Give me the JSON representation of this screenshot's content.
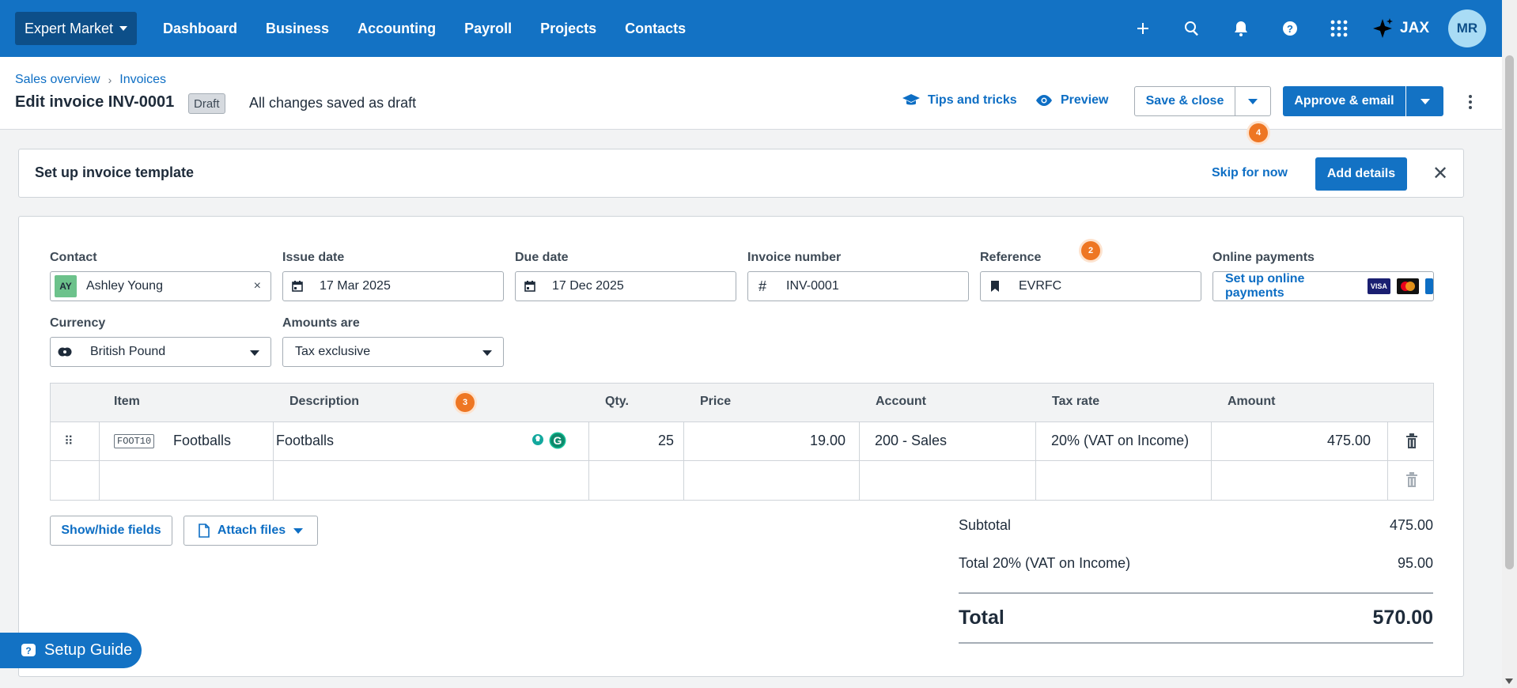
{
  "nav": {
    "org": "Expert Market",
    "items": [
      "Dashboard",
      "Business",
      "Accounting",
      "Payroll",
      "Projects",
      "Contacts"
    ],
    "jax": "JAX",
    "user_initials": "MR"
  },
  "breadcrumb": {
    "first": "Sales overview",
    "second": "Invoices"
  },
  "header": {
    "title": "Edit invoice INV-0001",
    "badge": "Draft",
    "status": "All changes saved as draft",
    "tips": "Tips and tricks",
    "preview": "Preview",
    "save_close": "Save & close",
    "approve_email": "Approve & email"
  },
  "markers": {
    "m2": "2",
    "m3": "3",
    "m4": "4"
  },
  "banner": {
    "title": "Set up invoice template",
    "skip": "Skip for now",
    "add_details": "Add details"
  },
  "form": {
    "contact_label": "Contact",
    "contact_initials": "AY",
    "contact_value": "Ashley Young",
    "issue_label": "Issue date",
    "issue_value": "17 Mar 2025",
    "due_label": "Due date",
    "due_value": "17 Dec 2025",
    "invoice_label": "Invoice number",
    "invoice_value": "INV-0001",
    "reference_label": "Reference",
    "reference_value": "EVRFC",
    "online_label": "Online payments",
    "online_link": "Set up online payments",
    "visa": "VISA",
    "currency_label": "Currency",
    "currency_value": "British Pound",
    "amounts_label": "Amounts are",
    "amounts_value": "Tax exclusive"
  },
  "table": {
    "headers": [
      "Item",
      "Description",
      "Qty.",
      "Price",
      "Account",
      "Tax rate",
      "Amount"
    ],
    "rows": [
      {
        "code": "FOOT10",
        "item": "Footballs",
        "description": "Footballs",
        "qty": "25",
        "price": "19.00",
        "account": "200 - Sales",
        "tax": "20% (VAT on Income)",
        "amount": "475.00"
      }
    ]
  },
  "actions": {
    "show_hide": "Show/hide fields",
    "attach": "Attach files"
  },
  "totals": {
    "subtotal_label": "Subtotal",
    "subtotal": "475.00",
    "vat_label": "Total 20% (VAT on Income)",
    "vat": "95.00",
    "total_label": "Total",
    "total": "570.00"
  },
  "setup_guide": "Setup Guide",
  "colors": {
    "brand": "#1372c4",
    "marker": "#ee7623"
  }
}
